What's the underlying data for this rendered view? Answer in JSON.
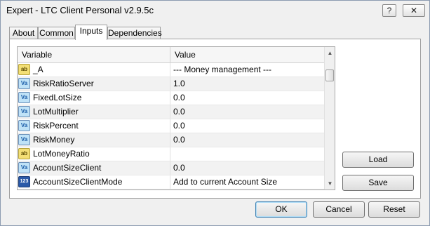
{
  "window": {
    "title": "Expert - LTC Client Personal v2.9.5c",
    "help_glyph": "?",
    "close_glyph": "✕"
  },
  "tabs": [
    {
      "label": "About"
    },
    {
      "label": "Common"
    },
    {
      "label": "Inputs",
      "active": true
    },
    {
      "label": "Dependencies"
    }
  ],
  "grid": {
    "columns": {
      "variable": "Variable",
      "value": "Value"
    },
    "rows": [
      {
        "icon": "ab",
        "icon_name": "string-type-icon",
        "variable": "_A",
        "value": "--- Money management ---"
      },
      {
        "icon": "Va",
        "icon_name": "double-type-icon",
        "variable": "RiskRatioServer",
        "value": "1.0"
      },
      {
        "icon": "Va",
        "icon_name": "double-type-icon",
        "variable": "FixedLotSize",
        "value": "0.0"
      },
      {
        "icon": "Va",
        "icon_name": "double-type-icon",
        "variable": "LotMultiplier",
        "value": "0.0"
      },
      {
        "icon": "Va",
        "icon_name": "double-type-icon",
        "variable": "RiskPercent",
        "value": "0.0"
      },
      {
        "icon": "Va",
        "icon_name": "double-type-icon",
        "variable": "RiskMoney",
        "value": "0.0"
      },
      {
        "icon": "ab",
        "icon_name": "string-type-icon",
        "variable": "LotMoneyRatio",
        "value": ""
      },
      {
        "icon": "Va",
        "icon_name": "double-type-icon",
        "variable": "AccountSizeClient",
        "value": "0.0"
      },
      {
        "icon": "123",
        "icon_name": "enum-type-icon",
        "variable": "AccountSizeClientMode",
        "value": "Add to current Account Size"
      }
    ]
  },
  "side_buttons": {
    "load": "Load",
    "save": "Save"
  },
  "footer_buttons": {
    "ok": "OK",
    "cancel": "Cancel",
    "reset": "Reset"
  }
}
